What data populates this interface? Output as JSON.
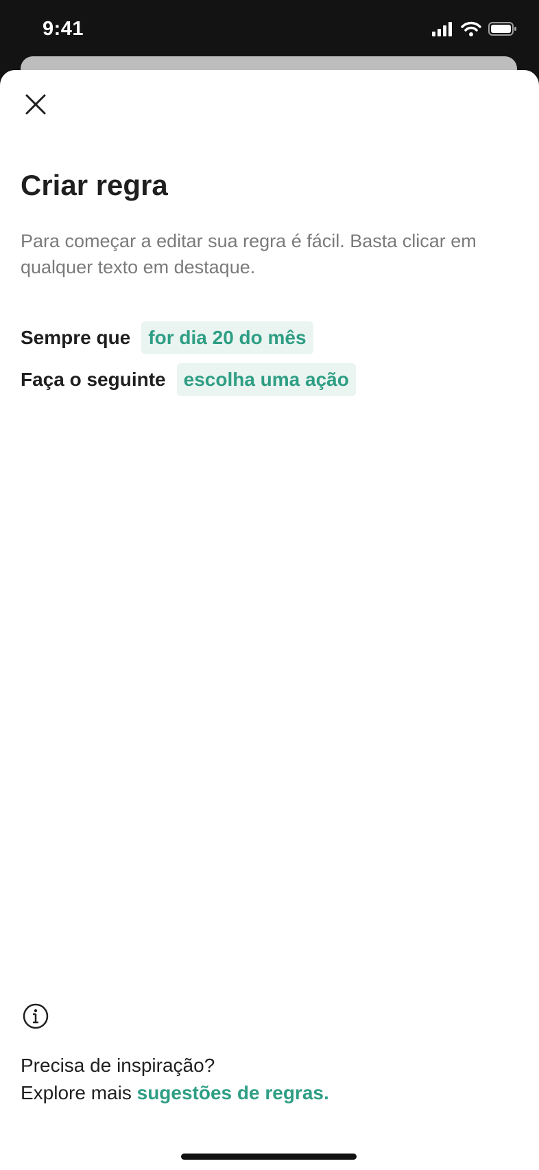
{
  "status_bar": {
    "time": "9:41"
  },
  "sheet": {
    "title": "Criar regra",
    "description": "Para começar a editar sua regra é fácil. Basta clicar em qualquer texto em destaque.",
    "rules": [
      {
        "label": "Sempre que",
        "value": "for dia 20 do mês"
      },
      {
        "label": "Faça o seguinte",
        "value": "escolha uma ação"
      }
    ],
    "footer": {
      "question": "Precisa de inspiração?",
      "explore_prefix": "Explore mais ",
      "link_text": "sugestões de regras."
    }
  },
  "icons": {
    "close": "close-icon",
    "info": "info-icon",
    "signal": "signal-icon",
    "wifi": "wifi-icon",
    "battery": "battery-icon"
  },
  "colors": {
    "accent": "#2e9e84",
    "chip_background": "#eaf4f0",
    "title": "#1f1f1f",
    "description": "#7a7a7a",
    "status_bar_background": "#131313"
  }
}
